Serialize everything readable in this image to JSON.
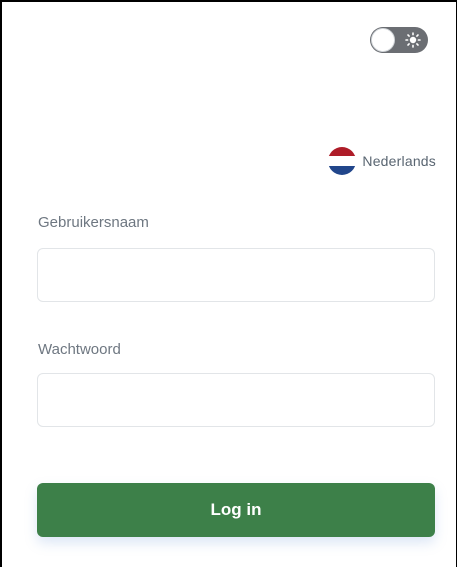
{
  "theme_toggle": {
    "icon": "sun-icon",
    "state": "off"
  },
  "language": {
    "label": "Nederlands",
    "flag": "netherlands-flag-icon",
    "flag_colors": [
      "#ae1c28",
      "#ffffff",
      "#21468b"
    ]
  },
  "form": {
    "username_label": "Gebruikersnaam",
    "username_value": "",
    "password_label": "Wachtwoord",
    "password_value": "",
    "login_label": "Log in"
  },
  "colors": {
    "primary_button": "#3d8049",
    "label_text": "#6e7781",
    "toggle_track": "#6b6e73"
  }
}
